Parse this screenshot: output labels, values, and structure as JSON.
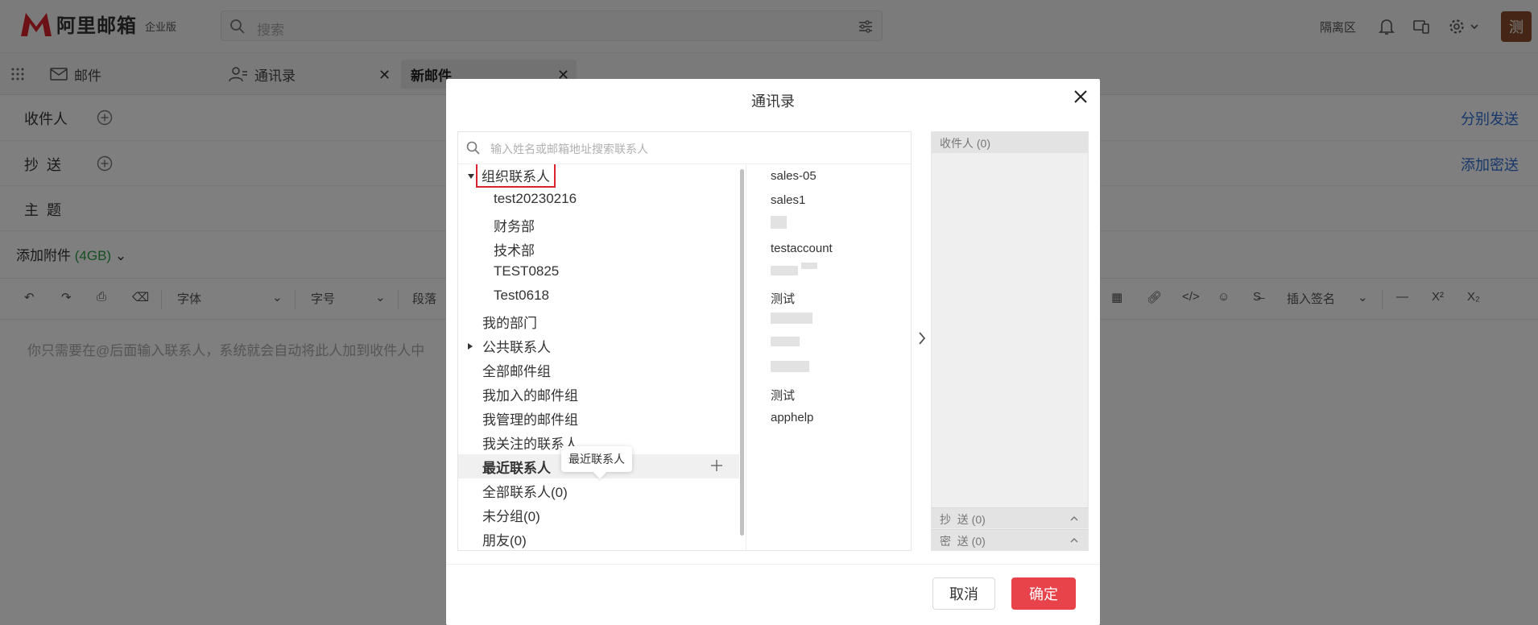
{
  "app": {
    "logo_text": "阿里邮箱",
    "edition": "企业版"
  },
  "topbar": {
    "search_placeholder": "搜索",
    "isolation_label": "隔离区",
    "avatar_text": "测"
  },
  "tabs": [
    {
      "label": "邮件"
    },
    {
      "label": "通讯录"
    },
    {
      "label": "新邮件"
    }
  ],
  "compose": {
    "to_label": "收件人",
    "cc_label": "抄  送",
    "subject_label": "主  题",
    "send_separately": "分别发送",
    "add_bcc": "添加密送",
    "attach_label": "添加附件",
    "attach_size": "(4GB)",
    "editor_placeholder": "你只需要在@后面输入联系人，系统就会自动将此人加到收件人中"
  },
  "toolbar": {
    "font_label": "字体",
    "size_label": "字号",
    "paragraph_label": "段落",
    "signature_label": "插入签名"
  },
  "dialog": {
    "title": "通讯录",
    "search_placeholder": "输入姓名或邮箱地址搜索联系人",
    "tree": [
      {
        "label": "组织联系人",
        "level": 0,
        "expanded": true
      },
      {
        "label": "test20230216",
        "level": 1
      },
      {
        "label": "财务部",
        "level": 1
      },
      {
        "label": "技术部",
        "level": 1
      },
      {
        "label": "TEST0825",
        "level": 1
      },
      {
        "label": "Test0618",
        "level": 1
      },
      {
        "label": "我的部门",
        "level": 0
      },
      {
        "label": "公共联系人",
        "level": 0,
        "expanded": false
      },
      {
        "label": "全部邮件组",
        "level": 0
      },
      {
        "label": "我加入的邮件组",
        "level": 0
      },
      {
        "label": "我管理的邮件组",
        "level": 0
      },
      {
        "label": "我关注的联系人",
        "level": 0
      },
      {
        "label": "最近联系人",
        "level": 0,
        "selected": true
      },
      {
        "label": "全部联系人(0)",
        "level": 0
      },
      {
        "label": "未分组(0)",
        "level": 0
      },
      {
        "label": "朋友(0)",
        "level": 0
      }
    ],
    "tooltip": "最近联系人",
    "names": [
      "sales-05",
      "sales1",
      "testaccount",
      "测试",
      "测试",
      "apphelp"
    ],
    "recipients_header": "收件人 (0)",
    "cc_footer": "抄  送 (0)",
    "bcc_footer": "密  送 (0)",
    "cancel_label": "取消",
    "ok_label": "确定"
  },
  "colors": {
    "brand_red": "#d9232d",
    "ok_button": "#e8424a",
    "link_blue": "#2f6fd6"
  }
}
